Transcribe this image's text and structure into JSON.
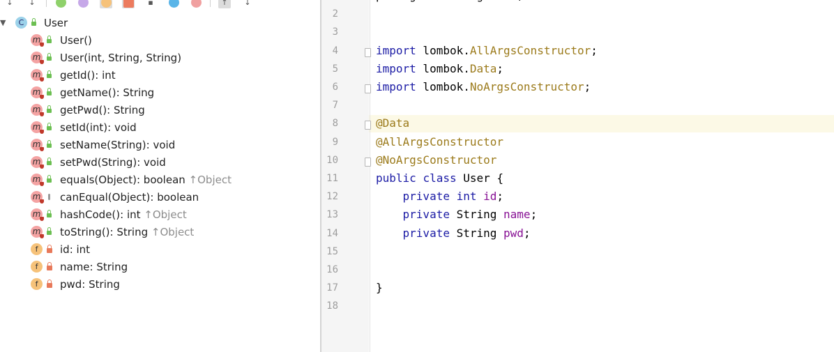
{
  "structure": {
    "root": {
      "kind": "c",
      "label": "User"
    },
    "members": [
      {
        "kind": "m",
        "vis": "pub",
        "sig": "User()",
        "ovr": ""
      },
      {
        "kind": "m",
        "vis": "pub",
        "sig": "User(int, String, String)",
        "ovr": ""
      },
      {
        "kind": "m",
        "vis": "pub",
        "sig": "getId(): int",
        "ovr": ""
      },
      {
        "kind": "m",
        "vis": "pub",
        "sig": "getName(): String",
        "ovr": ""
      },
      {
        "kind": "m",
        "vis": "pub",
        "sig": "getPwd(): String",
        "ovr": ""
      },
      {
        "kind": "m",
        "vis": "pub",
        "sig": "setId(int): void",
        "ovr": ""
      },
      {
        "kind": "m",
        "vis": "pub",
        "sig": "setName(String): void",
        "ovr": ""
      },
      {
        "kind": "m",
        "vis": "pub",
        "sig": "setPwd(String): void",
        "ovr": ""
      },
      {
        "kind": "m",
        "vis": "pub",
        "sig": "equals(Object): boolean",
        "ovr": "↑Object"
      },
      {
        "kind": "m",
        "vis": "pkg",
        "sig": "canEqual(Object): boolean",
        "ovr": ""
      },
      {
        "kind": "m",
        "vis": "pub",
        "sig": "hashCode(): int",
        "ovr": "↑Object"
      },
      {
        "kind": "m",
        "vis": "pub",
        "sig": "toString(): String",
        "ovr": "↑Object"
      },
      {
        "kind": "f",
        "vis": "priv",
        "sig": "id: int",
        "ovr": ""
      },
      {
        "kind": "f",
        "vis": "priv",
        "sig": "name: String",
        "ovr": ""
      },
      {
        "kind": "f",
        "vis": "priv",
        "sig": "pwd: String",
        "ovr": ""
      }
    ],
    "toolbar_icons": [
      "sort-visibility-icon",
      "sort-alpha-icon",
      "show-inherited-icon",
      "show-properties-icon",
      "show-fields-icon",
      "show-nonpublic-icon",
      "show-lambdas-icon",
      "show-anonymous-icon",
      "show-lambda-icon",
      "expand-all-icon",
      "collapse-all-icon"
    ]
  },
  "editor": {
    "caret_line": 8,
    "lines": [
      {
        "n": "1",
        "tokens": [
          {
            "t": "package com.feng.User;",
            "c": "plain"
          }
        ]
      },
      {
        "n": "2",
        "tokens": []
      },
      {
        "n": "3",
        "tokens": []
      },
      {
        "n": "4",
        "tokens": [
          {
            "t": "import",
            "c": "kw"
          },
          {
            "t": " lombok.",
            "c": "plain"
          },
          {
            "t": "AllArgsConstructor",
            "c": "cls"
          },
          {
            "t": ";",
            "c": "plain"
          }
        ],
        "fold": true
      },
      {
        "n": "5",
        "tokens": [
          {
            "t": "import",
            "c": "kw"
          },
          {
            "t": " lombok.",
            "c": "plain"
          },
          {
            "t": "Data",
            "c": "cls"
          },
          {
            "t": ";",
            "c": "plain"
          }
        ]
      },
      {
        "n": "6",
        "tokens": [
          {
            "t": "import",
            "c": "kw"
          },
          {
            "t": " lombok.",
            "c": "plain"
          },
          {
            "t": "NoArgsConstructor",
            "c": "cls"
          },
          {
            "t": ";",
            "c": "plain"
          }
        ],
        "fold": true
      },
      {
        "n": "7",
        "tokens": []
      },
      {
        "n": "8",
        "tokens": [
          {
            "t": "@Data",
            "c": "ann"
          }
        ],
        "fold": true
      },
      {
        "n": "9",
        "tokens": [
          {
            "t": "@AllArgsConstructor",
            "c": "ann"
          }
        ]
      },
      {
        "n": "10",
        "tokens": [
          {
            "t": "@NoArgsConstructor",
            "c": "ann"
          }
        ],
        "fold": true
      },
      {
        "n": "11",
        "tokens": [
          {
            "t": "public",
            "c": "kw"
          },
          {
            "t": " ",
            "c": "plain"
          },
          {
            "t": "class",
            "c": "kw"
          },
          {
            "t": " User {",
            "c": "plain"
          }
        ]
      },
      {
        "n": "12",
        "tokens": [
          {
            "t": "    ",
            "c": "plain"
          },
          {
            "t": "private",
            "c": "kw"
          },
          {
            "t": " ",
            "c": "plain"
          },
          {
            "t": "int",
            "c": "kw"
          },
          {
            "t": " ",
            "c": "plain"
          },
          {
            "t": "id",
            "c": "fld"
          },
          {
            "t": ";",
            "c": "plain"
          }
        ]
      },
      {
        "n": "13",
        "tokens": [
          {
            "t": "    ",
            "c": "plain"
          },
          {
            "t": "private",
            "c": "kw"
          },
          {
            "t": " String ",
            "c": "plain"
          },
          {
            "t": "name",
            "c": "fld"
          },
          {
            "t": ";",
            "c": "plain"
          }
        ]
      },
      {
        "n": "14",
        "tokens": [
          {
            "t": "    ",
            "c": "plain"
          },
          {
            "t": "private",
            "c": "kw"
          },
          {
            "t": " String ",
            "c": "plain"
          },
          {
            "t": "pwd",
            "c": "fld"
          },
          {
            "t": ";",
            "c": "plain"
          }
        ]
      },
      {
        "n": "15",
        "tokens": []
      },
      {
        "n": "16",
        "tokens": []
      },
      {
        "n": "17",
        "tokens": [
          {
            "t": "}",
            "c": "plain"
          }
        ]
      },
      {
        "n": "18",
        "tokens": []
      }
    ]
  }
}
